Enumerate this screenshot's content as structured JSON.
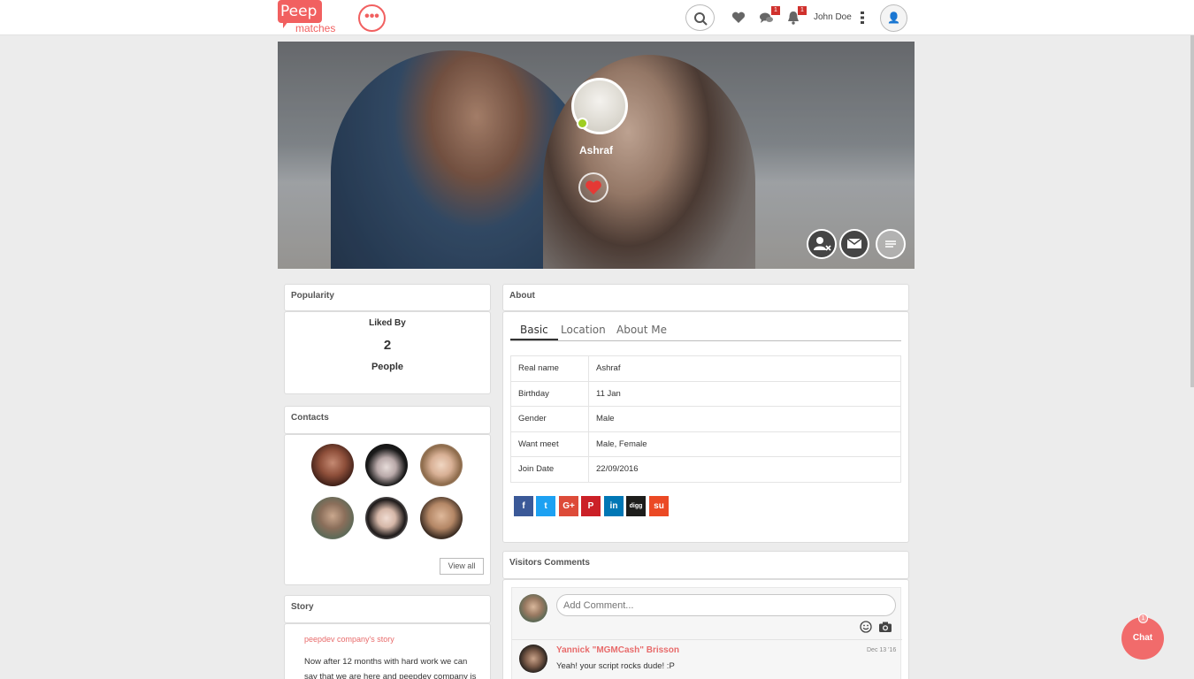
{
  "header": {
    "logo_text": "Peep",
    "logo_sub": "matches",
    "more_label": "•••",
    "messages_badge": "1",
    "notifications_badge": "1",
    "username": "John Doe",
    "avatar_glyph": "👤"
  },
  "profile": {
    "name": "Ashraf",
    "online": true
  },
  "popularity": {
    "title": "Popularity",
    "liked_by_label": "Liked By",
    "count": "2",
    "people_label": "People"
  },
  "contacts": {
    "title": "Contacts",
    "view_all_label": "View all"
  },
  "story": {
    "title": "Story",
    "link_text": "peepdev company's story",
    "text": "Now after 12 months with hard work we can say that we are here and peepdev company is"
  },
  "about": {
    "title": "About",
    "tabs": [
      "Basic",
      "Location",
      "About Me"
    ],
    "rows": [
      {
        "key": "Real name",
        "value": "Ashraf"
      },
      {
        "key": "Birthday",
        "value": "11 Jan"
      },
      {
        "key": "Gender",
        "value": "Male"
      },
      {
        "key": "Want meet",
        "value": "Male, Female"
      },
      {
        "key": "Join Date",
        "value": "22/09/2016"
      }
    ],
    "social": [
      {
        "name": "facebook",
        "glyph": "f",
        "color": "#3b5998"
      },
      {
        "name": "twitter",
        "glyph": "t",
        "color": "#1da1f2"
      },
      {
        "name": "google-plus",
        "glyph": "G+",
        "color": "#dd4b39"
      },
      {
        "name": "pinterest",
        "glyph": "P",
        "color": "#cb2027"
      },
      {
        "name": "linkedin",
        "glyph": "in",
        "color": "#0077b5"
      },
      {
        "name": "digg",
        "glyph": "digg",
        "color": "#1d1d1b"
      },
      {
        "name": "stumbleupon",
        "glyph": "su",
        "color": "#eb4924"
      }
    ]
  },
  "comments": {
    "title": "Visitors Comments",
    "placeholder": "Add Comment...",
    "items": [
      {
        "author": "Yannick \"MGMCash\" Brisson",
        "date": "Dec 13 '16",
        "text": "Yeah! your script rocks dude! :P"
      }
    ]
  },
  "chat": {
    "label": "Chat",
    "count": "1"
  },
  "colors": {
    "brand": "#f16060",
    "online": "#9fce22"
  }
}
